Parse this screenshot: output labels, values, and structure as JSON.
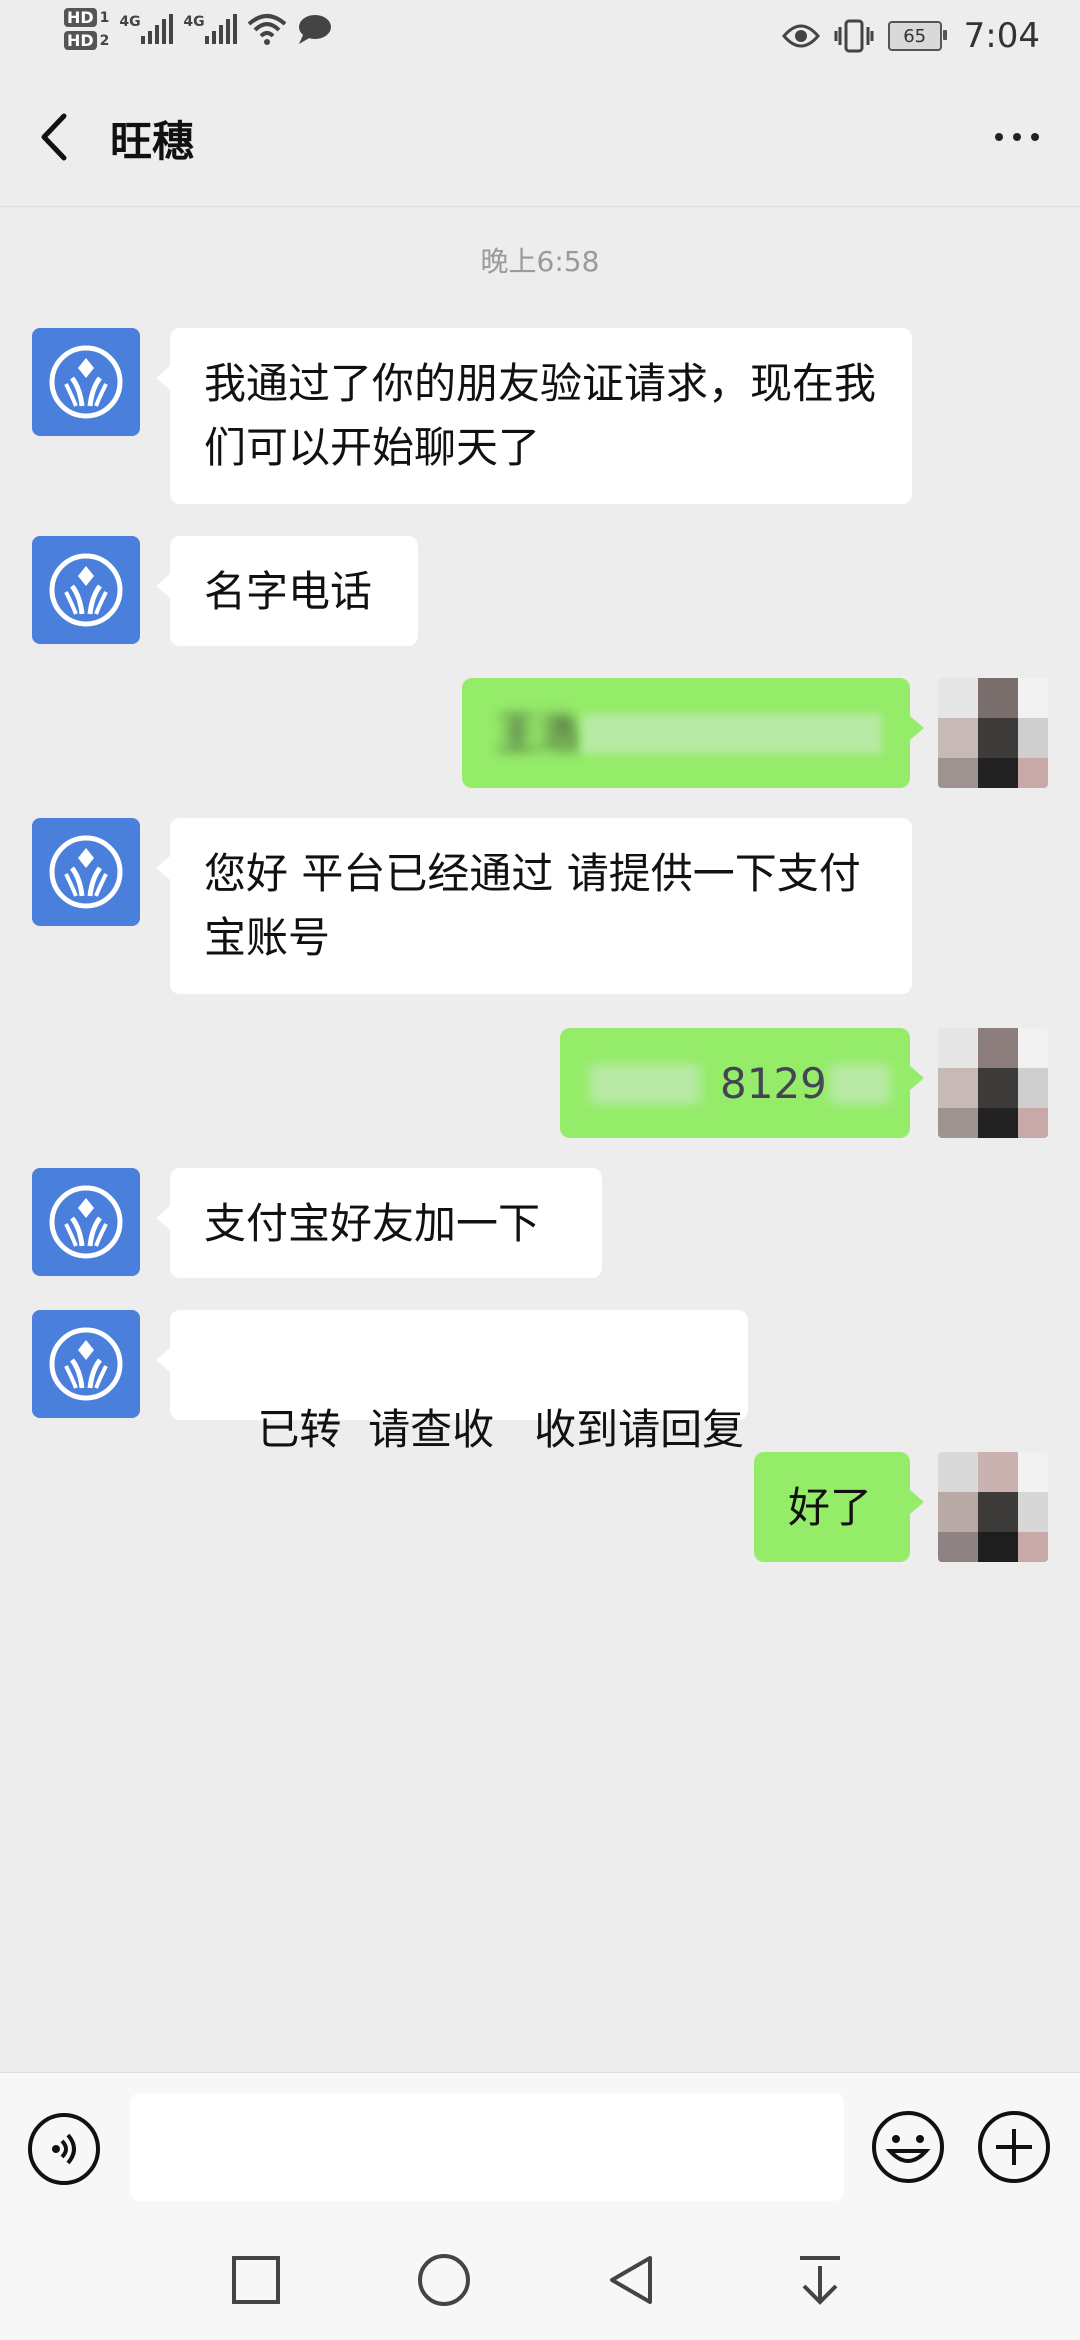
{
  "status_bar": {
    "hd1": "HD",
    "hd1_sub": "1",
    "hd2": "HD",
    "hd2_sub": "2",
    "net1": "4G",
    "net2": "4G",
    "battery": "65",
    "time": "7:04"
  },
  "header": {
    "title": "旺穗"
  },
  "chat": {
    "timestamp": "晚上6:58",
    "messages": [
      {
        "from": "other",
        "text": "我通过了你的朋友验证请求，现在我们可以开始聊天了"
      },
      {
        "from": "other",
        "text": "名字电话"
      },
      {
        "from": "me",
        "text": "王浩",
        "visible_fragment": "王浩"
      },
      {
        "from": "other",
        "text": "您好 平台已经通过 请提供一下支付宝账号"
      },
      {
        "from": "me",
        "text": "8129",
        "visible_fragment": "8129"
      },
      {
        "from": "other",
        "text": "支付宝好友加一下"
      },
      {
        "from": "other",
        "text": "已转  请查收   收到请回复"
      },
      {
        "from": "me",
        "text": "好了"
      }
    ]
  },
  "input": {
    "placeholder": ""
  },
  "colors": {
    "background": "#ededed",
    "bubble_out": "#95ec69",
    "bubble_in": "#ffffff",
    "avatar_bot": "#4a7fdc"
  },
  "icons": {
    "back": "chevron-left-icon",
    "more": "more-dots-icon",
    "voice": "voice-icon",
    "emoji": "emoji-icon",
    "plus": "plus-icon",
    "nav_recent": "square-icon",
    "nav_home": "circle-icon",
    "nav_back": "triangle-back-icon",
    "nav_notif": "pull-down-icon"
  }
}
